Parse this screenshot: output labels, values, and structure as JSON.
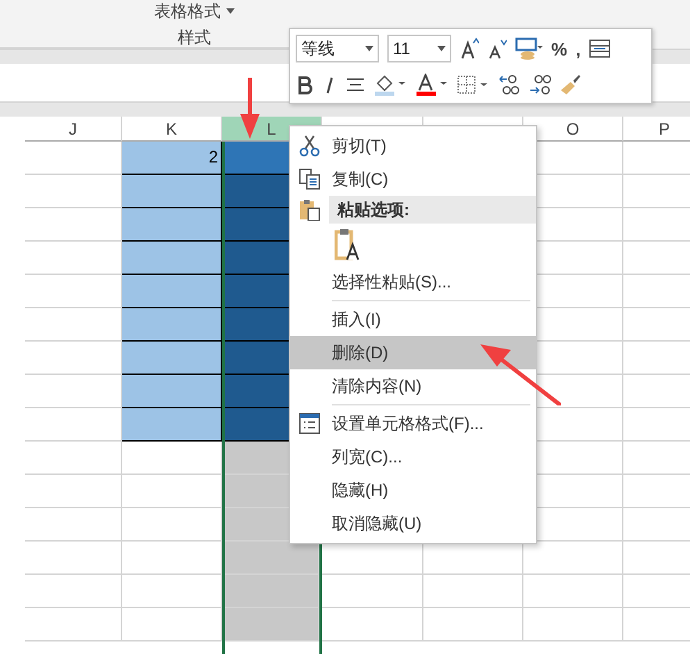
{
  "ribbon": {
    "format_table_label": "表格格式",
    "group_label": "样式"
  },
  "mini_toolbar": {
    "font": "等线",
    "size": "11",
    "percent": "%",
    "comma": ","
  },
  "sheet": {
    "columns": [
      {
        "label": "J",
        "selected": false,
        "kind": "plain"
      },
      {
        "label": "K",
        "selected": false,
        "kind": "filled",
        "cells": [
          "2"
        ]
      },
      {
        "label": "L",
        "selected": true,
        "kind": "filled"
      },
      {
        "selected": false,
        "kind": "plain"
      },
      {
        "selected": false,
        "kind": "plain"
      },
      {
        "label": "O",
        "selected": false,
        "kind": "plain"
      },
      {
        "label": "P",
        "selected": false,
        "kind": "plain"
      }
    ]
  },
  "context_menu": {
    "items": [
      {
        "kind": "cut",
        "label": "剪切(T)",
        "selected": false
      },
      {
        "kind": "copy",
        "label": "复制(C)",
        "selected": false
      },
      {
        "kind": "header",
        "label": "粘贴选项:"
      },
      {
        "kind": "paste_options"
      },
      {
        "kind": "item",
        "label": "选择性粘贴(S)...",
        "selected": false
      },
      {
        "kind": "separator"
      },
      {
        "kind": "item",
        "label": "插入(I)",
        "selected": false
      },
      {
        "kind": "item",
        "label": "删除(D)",
        "selected": true
      },
      {
        "kind": "item",
        "label": "清除内容(N)",
        "selected": false
      },
      {
        "kind": "separator"
      },
      {
        "kind": "format",
        "label": "设置单元格格式(F)...",
        "selected": false
      },
      {
        "kind": "item",
        "label": "列宽(C)...",
        "selected": false
      },
      {
        "kind": "item",
        "label": "隐藏(H)",
        "selected": false
      },
      {
        "kind": "item",
        "label": "取消隐藏(U)",
        "selected": false
      }
    ]
  }
}
